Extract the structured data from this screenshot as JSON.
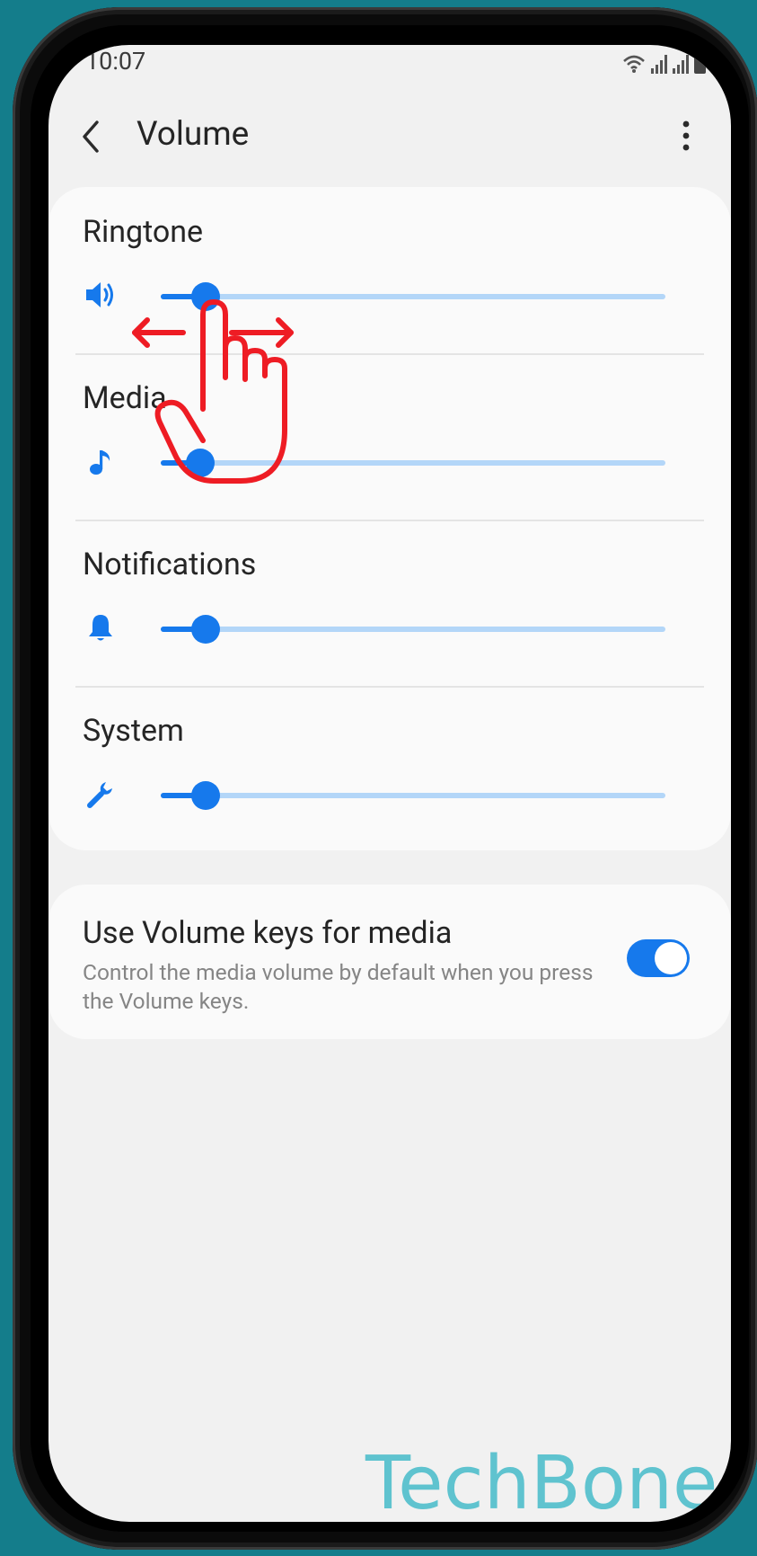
{
  "status_bar": {
    "time": "10:07",
    "icons": [
      "wifi-icon",
      "signal-icon",
      "signal-icon",
      "battery-icon"
    ]
  },
  "app_bar": {
    "title": "Volume",
    "back_icon": "chevron-left-icon",
    "more_icon": "more-vertical-icon"
  },
  "volumes": [
    {
      "label": "Ringtone",
      "icon": "speaker-icon",
      "level_fraction": 0.06
    },
    {
      "label": "Media",
      "icon": "music-note-icon",
      "level_fraction": 0.05
    },
    {
      "label": "Notifications",
      "icon": "bell-icon",
      "level_fraction": 0.06
    },
    {
      "label": "System",
      "icon": "wrench-icon",
      "level_fraction": 0.06
    }
  ],
  "volume_keys": {
    "title": "Use Volume keys for media",
    "description": "Control the media volume by default when you press the Volume keys.",
    "enabled": true
  },
  "overlay": {
    "gesture_icon": "swipe-horizontal-hand-icon"
  },
  "watermark": "TechBone",
  "colors": {
    "accent": "#1679ec",
    "track": "#b3d6f8",
    "background": "#f1f1f1",
    "card": "#fafafa",
    "outer_background": "#147d8b",
    "gesture": "#ee1c24",
    "watermark": "#5fc3cf"
  }
}
